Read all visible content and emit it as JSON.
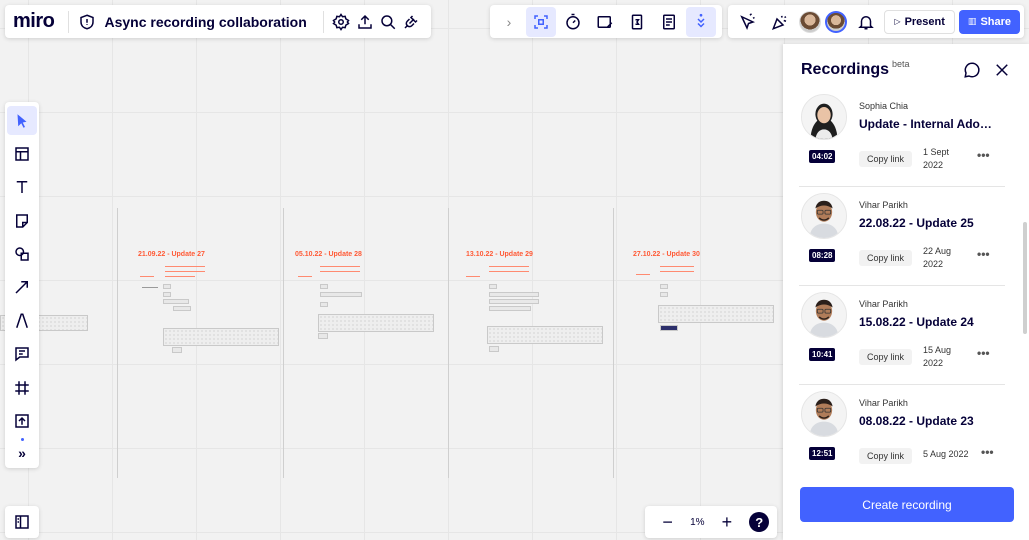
{
  "app": {
    "logo": "miro",
    "board_title": "Async recording collaboration"
  },
  "topbar": {
    "present_label": "Present",
    "share_label": "Share",
    "accent_color": "#4262ff"
  },
  "zoom": {
    "minus": "−",
    "value": "1%",
    "plus": "+",
    "help": "?"
  },
  "canvas": {
    "frames": [
      {
        "title": "21.09.22 - Update 27"
      },
      {
        "title": "05.10.22 - Update 28"
      },
      {
        "title": "13.10.22 - Update 29"
      },
      {
        "title": "27.10.22 - Update 30"
      }
    ]
  },
  "recordings": {
    "title": "Recordings",
    "beta": "beta",
    "copy_link_label": "Copy link",
    "more_label": "•••",
    "items": [
      {
        "author": "Sophia Chia",
        "name": "Update - Internal Adoption",
        "duration": "04:02",
        "date_line1": "1 Sept",
        "date_line2": "2022"
      },
      {
        "author": "Vihar Parikh",
        "name": "22.08.22 - Update 25",
        "duration": "08:28",
        "date_line1": "22 Aug",
        "date_line2": "2022"
      },
      {
        "author": "Vihar Parikh",
        "name": "15.08.22 - Update 24",
        "duration": "10:41",
        "date_line1": "15 Aug",
        "date_line2": "2022"
      },
      {
        "author": "Vihar Parikh",
        "name": "08.08.22 - Update 23",
        "duration": "12:51",
        "date_line1": "5 Aug 2022",
        "date_line2": ""
      }
    ],
    "create_label": "Create recording"
  }
}
